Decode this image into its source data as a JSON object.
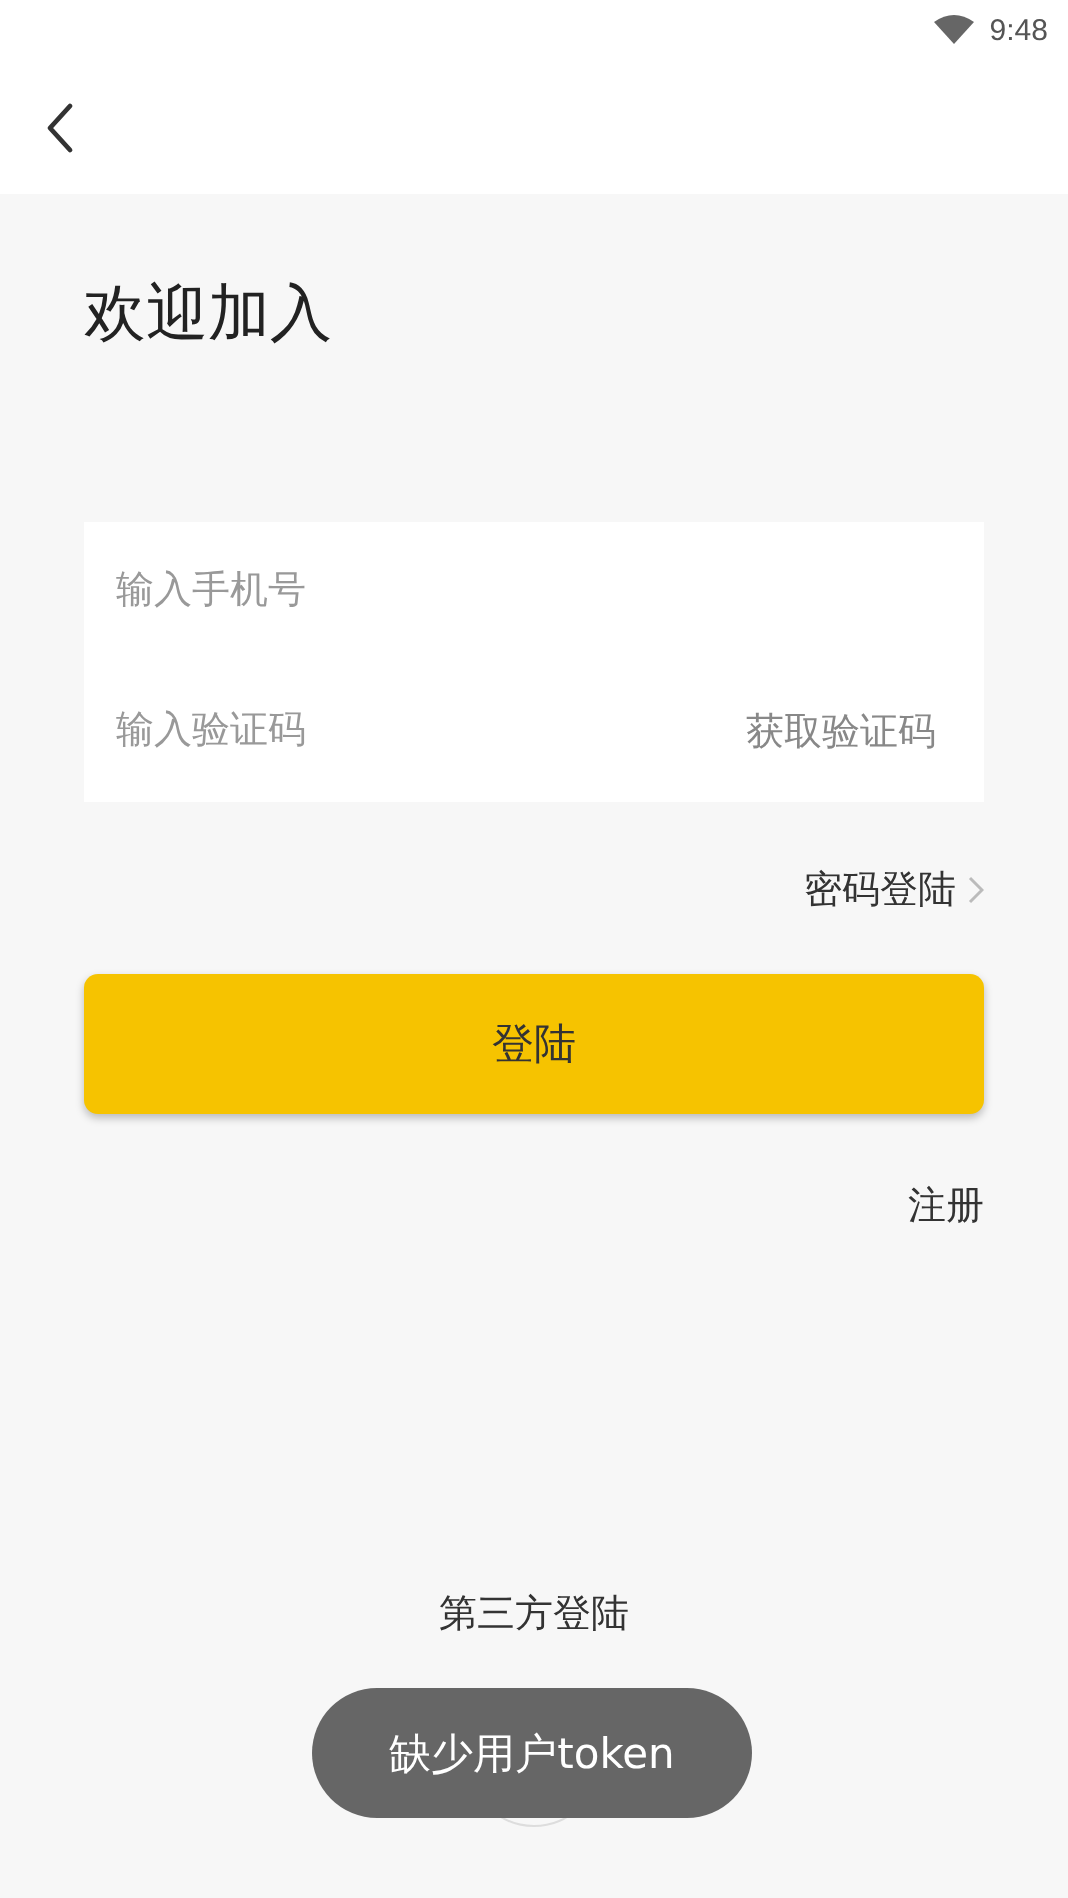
{
  "status_bar": {
    "time": "9:48"
  },
  "title": "欢迎加入",
  "form": {
    "phone": {
      "placeholder": "输入手机号"
    },
    "code": {
      "placeholder": "输入验证码"
    },
    "get_code": "获取验证码"
  },
  "password_login": "密码登陆",
  "login_button": "登陆",
  "register": "注册",
  "third_party": {
    "label": "第三方登陆"
  },
  "toast": "缺少用户token"
}
